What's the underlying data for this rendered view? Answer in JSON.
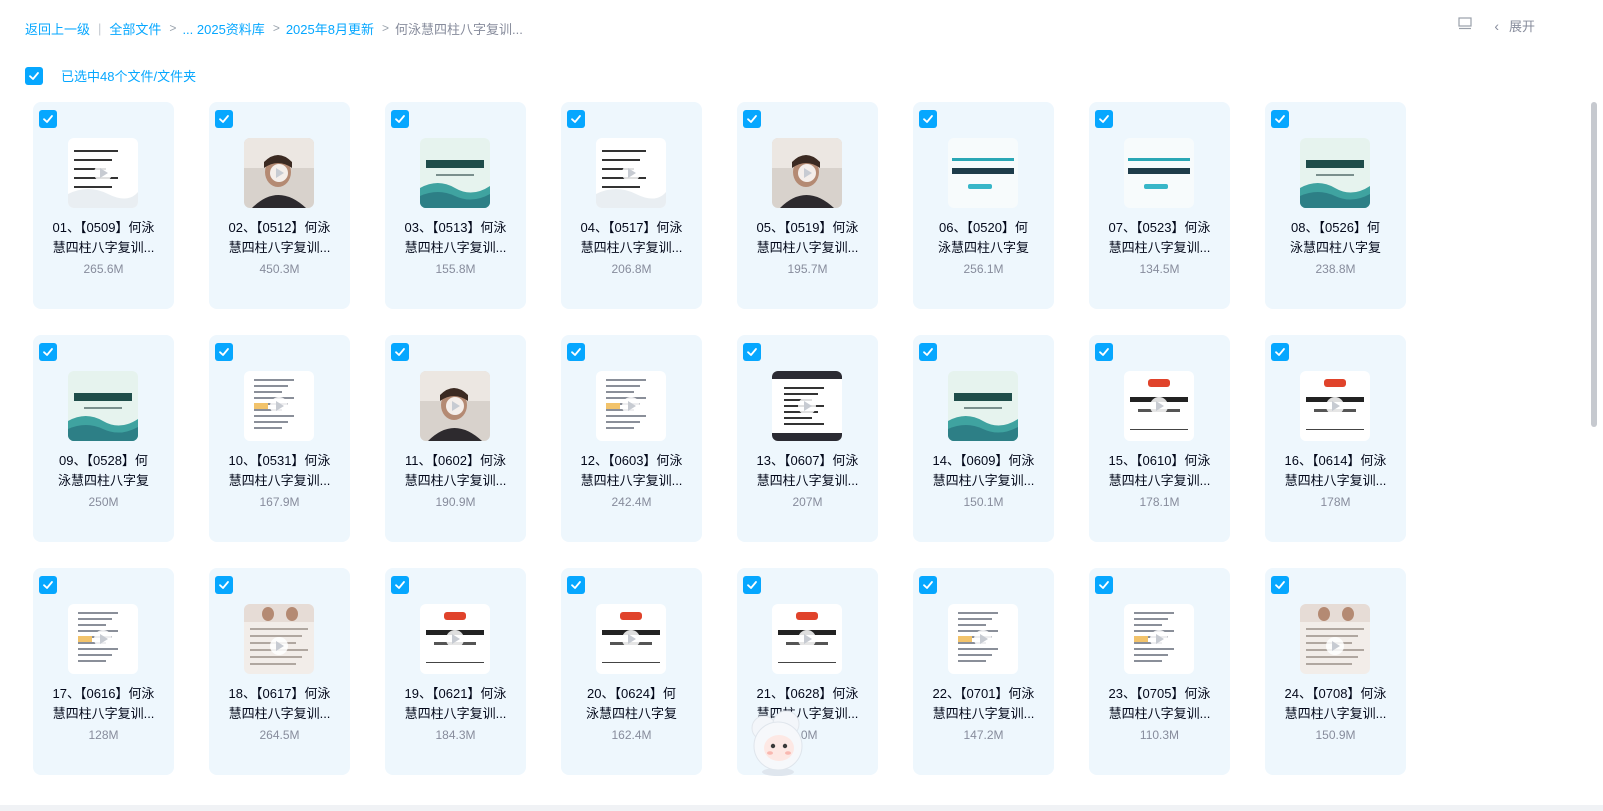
{
  "breadcrumb": {
    "back": "返回上一级",
    "items": [
      "全部文件",
      "... 2025资料库",
      "2025年8月更新"
    ],
    "current": "何泳慧四柱八字复训..."
  },
  "toolbar": {
    "expand_label": "展开",
    "list_icon": "list-view-icon",
    "chevron_icon": "chevron-left-icon"
  },
  "selection": {
    "label": "已选中48个文件/文件夹"
  },
  "colors": {
    "accent": "#06a7ff",
    "card_bg": "#eef7fd",
    "text": "#03081a",
    "muted": "#878c9c"
  },
  "files": [
    {
      "line1": "01、【0509】何泳",
      "line2": "慧四柱八字复训...",
      "size": "265.6M",
      "thumb": "text-white"
    },
    {
      "line1": "02、【0512】何泳",
      "line2": "慧四柱八字复训...",
      "size": "450.3M",
      "thumb": "video-person"
    },
    {
      "line1": "03、【0513】何泳",
      "line2": "慧四柱八字复训...",
      "size": "155.8M",
      "thumb": "teal-title"
    },
    {
      "line1": "04、【0517】何泳",
      "line2": "慧四柱八字复训...",
      "size": "206.8M",
      "thumb": "text-white"
    },
    {
      "line1": "05、【0519】何泳",
      "line2": "慧四柱八字复训...",
      "size": "195.7M",
      "thumb": "video-person"
    },
    {
      "line1": "06、【0520】何",
      "line2": "泳慧四柱八字复",
      "size": "256.1M",
      "thumb": "slide-cyan"
    },
    {
      "line1": "07、【0523】何泳",
      "line2": "慧四柱八字复训...",
      "size": "134.5M",
      "thumb": "slide-cyan"
    },
    {
      "line1": "08、【0526】何",
      "line2": "泳慧四柱八字复",
      "size": "238.8M",
      "thumb": "teal-title"
    },
    {
      "line1": "09、【0528】何",
      "line2": "泳慧四柱八字复",
      "size": "250M",
      "thumb": "teal-title"
    },
    {
      "line1": "10、【0531】何泳",
      "line2": "慧四柱八字复训...",
      "size": "167.9M",
      "thumb": "doc-white"
    },
    {
      "line1": "11、【0602】何泳",
      "line2": "慧四柱八字复训...",
      "size": "190.9M",
      "thumb": "video-person"
    },
    {
      "line1": "12、【0603】何泳",
      "line2": "慧四柱八字复训...",
      "size": "242.4M",
      "thumb": "doc-white"
    },
    {
      "line1": "13、【0607】何泳",
      "line2": "慧四柱八字复训...",
      "size": "207M",
      "thumb": "screen-doc"
    },
    {
      "line1": "14、【0609】何泳",
      "line2": "慧四柱八字复训...",
      "size": "150.1M",
      "thumb": "teal-title"
    },
    {
      "line1": "15、【0610】何泳",
      "line2": "慧四柱八字复训...",
      "size": "178.1M",
      "thumb": "slide-red"
    },
    {
      "line1": "16、【0614】何泳",
      "line2": "慧四柱八字复训...",
      "size": "178M",
      "thumb": "slide-red"
    },
    {
      "line1": "17、【0616】何泳",
      "line2": "慧四柱八字复训...",
      "size": "128M",
      "thumb": "doc-white"
    },
    {
      "line1": "18、【0617】何泳",
      "line2": "慧四柱八字复训...",
      "size": "264.5M",
      "thumb": "video-mixed"
    },
    {
      "line1": "19、【0621】何泳",
      "line2": "慧四柱八字复训...",
      "size": "184.3M",
      "thumb": "slide-red"
    },
    {
      "line1": "20、【0624】何",
      "line2": "泳慧四柱八字复",
      "size": "162.4M",
      "thumb": "slide-red"
    },
    {
      "line1": "21、【0628】何泳",
      "line2": "慧四柱八字复训...",
      "size": ".0M",
      "thumb": "slide-red"
    },
    {
      "line1": "22、【0701】何泳",
      "line2": "慧四柱八字复训...",
      "size": "147.2M",
      "thumb": "doc-white"
    },
    {
      "line1": "23、【0705】何泳",
      "line2": "慧四柱八字复训...",
      "size": "110.3M",
      "thumb": "doc-white"
    },
    {
      "line1": "24、【0708】何泳",
      "line2": "慧四柱八字复训...",
      "size": "150.9M",
      "thumb": "video-mixed"
    }
  ]
}
